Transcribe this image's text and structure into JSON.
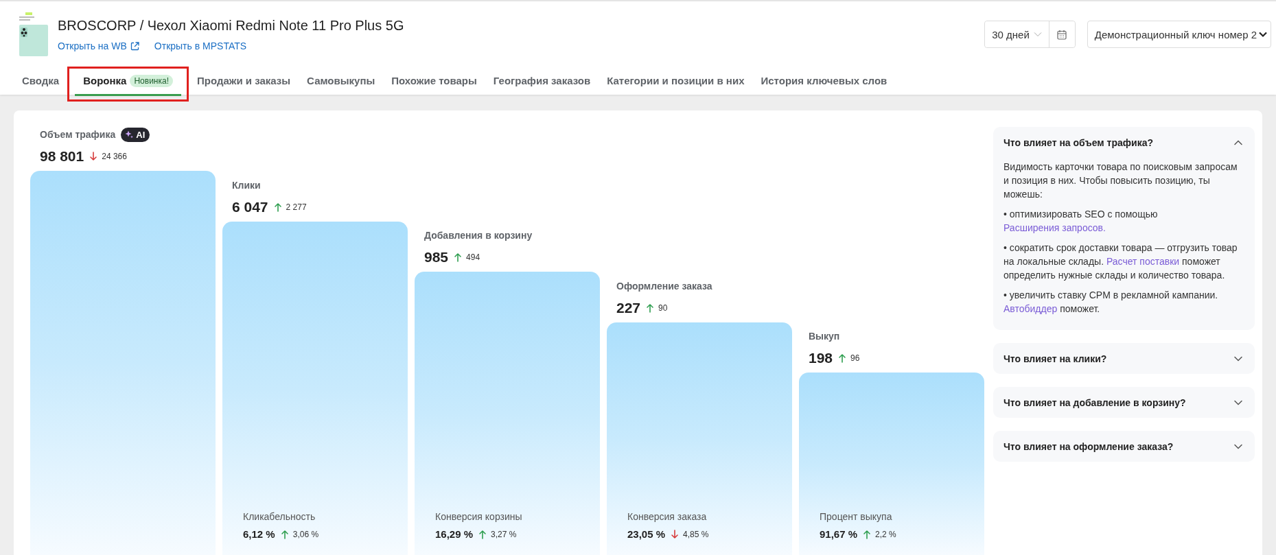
{
  "product": {
    "title": "BROSCORP / Чехол Xiaomi Redmi Note 11 Pro Plus 5G",
    "links": [
      {
        "label": "Открыть на WB",
        "external": true
      },
      {
        "label": "Открыть в MPSTATS",
        "external": false
      }
    ]
  },
  "period": {
    "value": "30 дней"
  },
  "api_key": {
    "value": "Демонстрационный ключ номер 2"
  },
  "tabs": [
    {
      "label": "Сводка",
      "selected": false,
      "highlighted": false
    },
    {
      "label": "Воронка",
      "badge": "Новинка!",
      "selected": true,
      "highlighted": true
    },
    {
      "label": "Продажи и заказы",
      "selected": false,
      "highlighted": false
    },
    {
      "label": "Самовыкупы",
      "selected": false,
      "highlighted": false
    },
    {
      "label": "Похожие товары",
      "selected": false,
      "highlighted": false
    },
    {
      "label": "География заказов",
      "selected": false,
      "highlighted": false
    },
    {
      "label": "Категории и позиции в них",
      "selected": false,
      "highlighted": false
    },
    {
      "label": "История ключевых слов",
      "selected": false,
      "highlighted": false
    }
  ],
  "funnel": {
    "stages": [
      {
        "label": "Объем трафика",
        "ai_badge": "AI",
        "value": "98 801",
        "delta": "24 366",
        "increased": false
      },
      {
        "label": "Клики",
        "value": "6 047",
        "delta": "2 277",
        "increased": true,
        "conversion": {
          "label": "Кликабельность",
          "value": "6,12 %",
          "delta": "3,06 %",
          "increased": true
        }
      },
      {
        "label": "Добавления в корзину",
        "value": "985",
        "delta": "494",
        "increased": true,
        "conversion": {
          "label": "Конверсия корзины",
          "value": "16,29 %",
          "delta": "3,27 %",
          "increased": true
        }
      },
      {
        "label": "Оформление заказа",
        "value": "227",
        "delta": "90",
        "increased": true,
        "conversion": {
          "label": "Конверсия заказа",
          "value": "23,05 %",
          "delta": "4,85 %",
          "increased": false
        }
      },
      {
        "label": "Выкуп",
        "value": "198",
        "delta": "96",
        "increased": true,
        "conversion": {
          "label": "Процент выкупа",
          "value": "91,67 %",
          "delta": "2,2 %",
          "increased": true
        }
      }
    ]
  },
  "tips": [
    {
      "title": "Что влияет на объем трафика?",
      "expanded": true,
      "paragraphs": [
        [
          {
            "text": "Видимость карточки товара по поисковым запросам и позиция в них. Чтобы повысить позицию, ты можешь:"
          }
        ],
        [
          {
            "text": "• оптимизировать SEO с помощью "
          },
          {
            "text": "Расширения запросов.",
            "link": true
          }
        ],
        [
          {
            "text": "• сократить срок доставки товара — отгрузить товар на локальные склады. "
          },
          {
            "text": "Расчет поставки",
            "link": true
          },
          {
            "text": " поможет определить нужные склады и количество товара."
          }
        ],
        [
          {
            "text": "• увеличить ставку CPM в рекламной кампании. "
          },
          {
            "text": "Автобиддер",
            "link": true
          },
          {
            "text": " поможет."
          }
        ]
      ]
    },
    {
      "title": "Что влияет на клики?",
      "expanded": false
    },
    {
      "title": "Что влияет на добавление в корзину?",
      "expanded": false
    },
    {
      "title": "Что влияет на оформление заказа?",
      "expanded": false
    }
  ]
}
